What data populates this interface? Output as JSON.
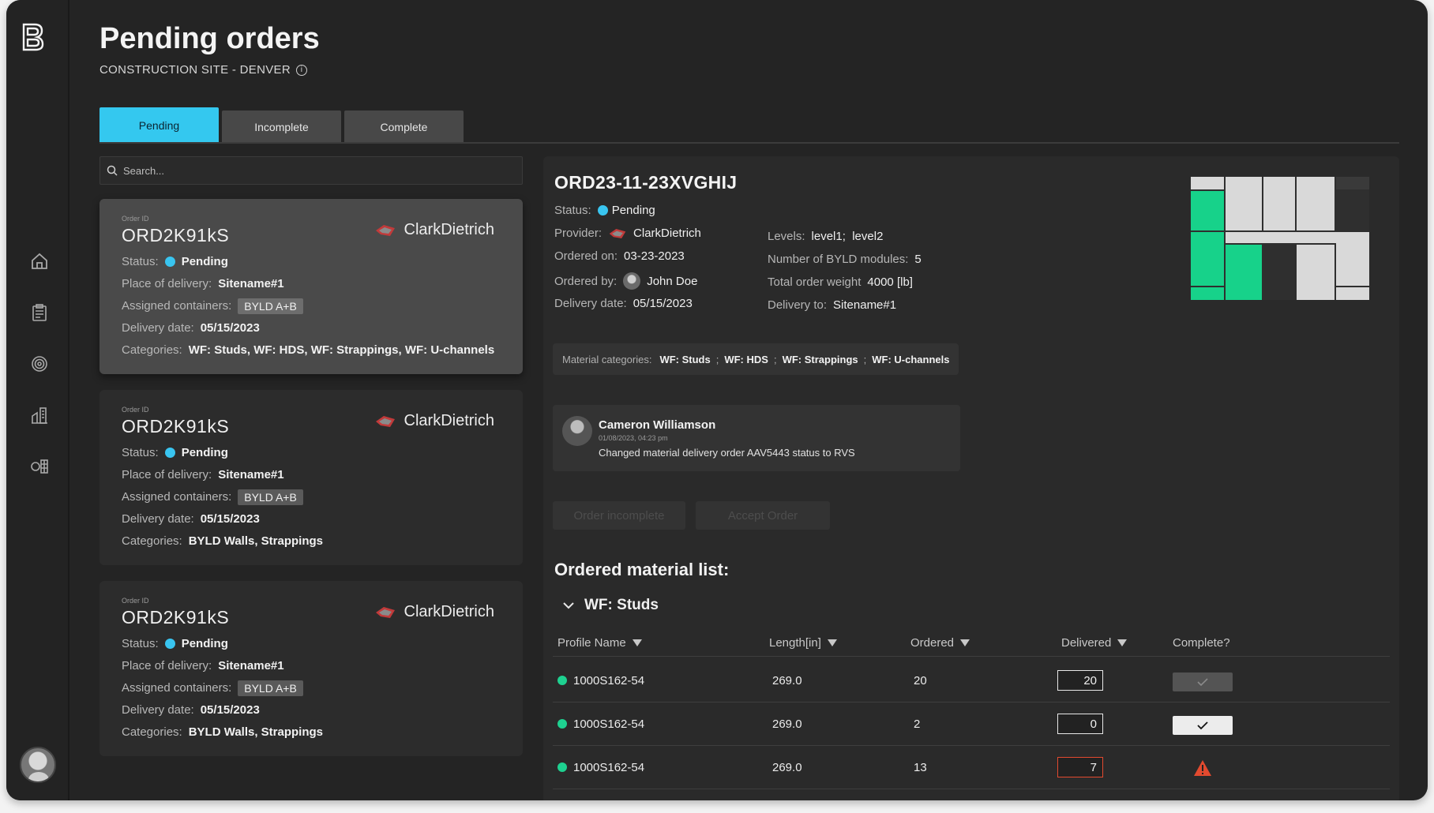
{
  "page": {
    "title": "Pending orders",
    "subtitle": "CONSTRUCTION SITE - DENVER"
  },
  "tabs": [
    {
      "label": "Pending",
      "active": true
    },
    {
      "label": "Incomplete",
      "active": false
    },
    {
      "label": "Complete",
      "active": false
    }
  ],
  "search": {
    "placeholder": "Search..."
  },
  "orders": [
    {
      "id_label": "Order ID",
      "id": "ORD2K91kS",
      "provider": "ClarkDietrich",
      "status_label": "Status:",
      "status": "Pending",
      "place_label": "Place of delivery:",
      "place": "Sitename#1",
      "containers_label": "Assigned containers:",
      "containers": "BYLD A+B",
      "date_label": "Delivery date:",
      "date": "05/15/2023",
      "categories_label": "Categories:",
      "categories": "WF: Studs, WF: HDS, WF: Strappings, WF: U-channels"
    },
    {
      "id_label": "Order ID",
      "id": "ORD2K91kS",
      "provider": "ClarkDietrich",
      "status_label": "Status:",
      "status": "Pending",
      "place_label": "Place of delivery:",
      "place": "Sitename#1",
      "containers_label": "Assigned containers:",
      "containers": "BYLD A+B",
      "date_label": "Delivery date:",
      "date": "05/15/2023",
      "categories_label": "Categories:",
      "categories": "BYLD Walls, Strappings"
    },
    {
      "id_label": "Order ID",
      "id": "ORD2K91kS",
      "provider": "ClarkDietrich",
      "status_label": "Status:",
      "status": "Pending",
      "place_label": "Place of delivery:",
      "place": "Sitename#1",
      "containers_label": "Assigned containers:",
      "containers": "BYLD A+B",
      "date_label": "Delivery date:",
      "date": "05/15/2023",
      "categories_label": "Categories:",
      "categories": "BYLD Walls, Strappings"
    }
  ],
  "detail": {
    "order_id": "ORD23-11-23XVGHIJ",
    "status_label": "Status:",
    "status": "Pending",
    "provider_label": "Provider:",
    "provider": "ClarkDietrich",
    "ordered_on_label": "Ordered on:",
    "ordered_on": "03-23-2023",
    "ordered_by_label": "Ordered by:",
    "ordered_by": "John Doe",
    "delivery_date_label": "Delivery date:",
    "delivery_date": "05/15/2023",
    "levels_label": "Levels:",
    "levels": "level1;  level2",
    "modules_label": "Number of BYLD modules:",
    "modules": "5",
    "weight_label": "Total order weight",
    "weight": "4000 [lb]",
    "delivery_to_label": "Delivery to:",
    "delivery_to": "Sitename#1",
    "material_categories_label": "Material categories:",
    "material_categories": [
      "WF: Studs",
      "WF: HDS",
      "WF: Strappings",
      "WF: U-channels"
    ],
    "activity": {
      "name": "Cameron Williamson",
      "time": "01/08/2023, 04:23 pm",
      "text": "Changed material delivery order AAV5443 status to RVS"
    },
    "buttons": {
      "incomplete": "Order incomplete",
      "accept": "Accept Order"
    },
    "material_list_title": "Ordered material list:",
    "group": "WF: Studs",
    "columns": [
      "Profile Name",
      "Length[in]",
      "Ordered",
      "Delivered",
      "Complete?"
    ],
    "rows": [
      {
        "profile": "1000S162-54",
        "length": "269.0",
        "ordered": "20",
        "delivered": "20",
        "complete": "unchecked"
      },
      {
        "profile": "1000S162-54",
        "length": "269.0",
        "ordered": "2",
        "delivered": "0",
        "complete": "checked"
      },
      {
        "profile": "1000S162-54",
        "length": "269.0",
        "ordered": "13",
        "delivered": "7",
        "complete": "warning"
      }
    ]
  },
  "colors": {
    "accent": "#34c8ef",
    "status_pending": "#39c5f0",
    "module_green": "#17d28a",
    "module_grey": "#d9d9d9",
    "warning": "#e24a2f",
    "background": "#242424"
  },
  "icons": [
    "byld-logo-icon",
    "home-icon",
    "clipboard-icon",
    "target-icon",
    "building-icon",
    "container-icon",
    "info-icon",
    "search-icon",
    "clarkdietrich-logo-icon",
    "chevron-down-icon",
    "sort-triangle-icon",
    "check-icon",
    "warning-icon"
  ]
}
